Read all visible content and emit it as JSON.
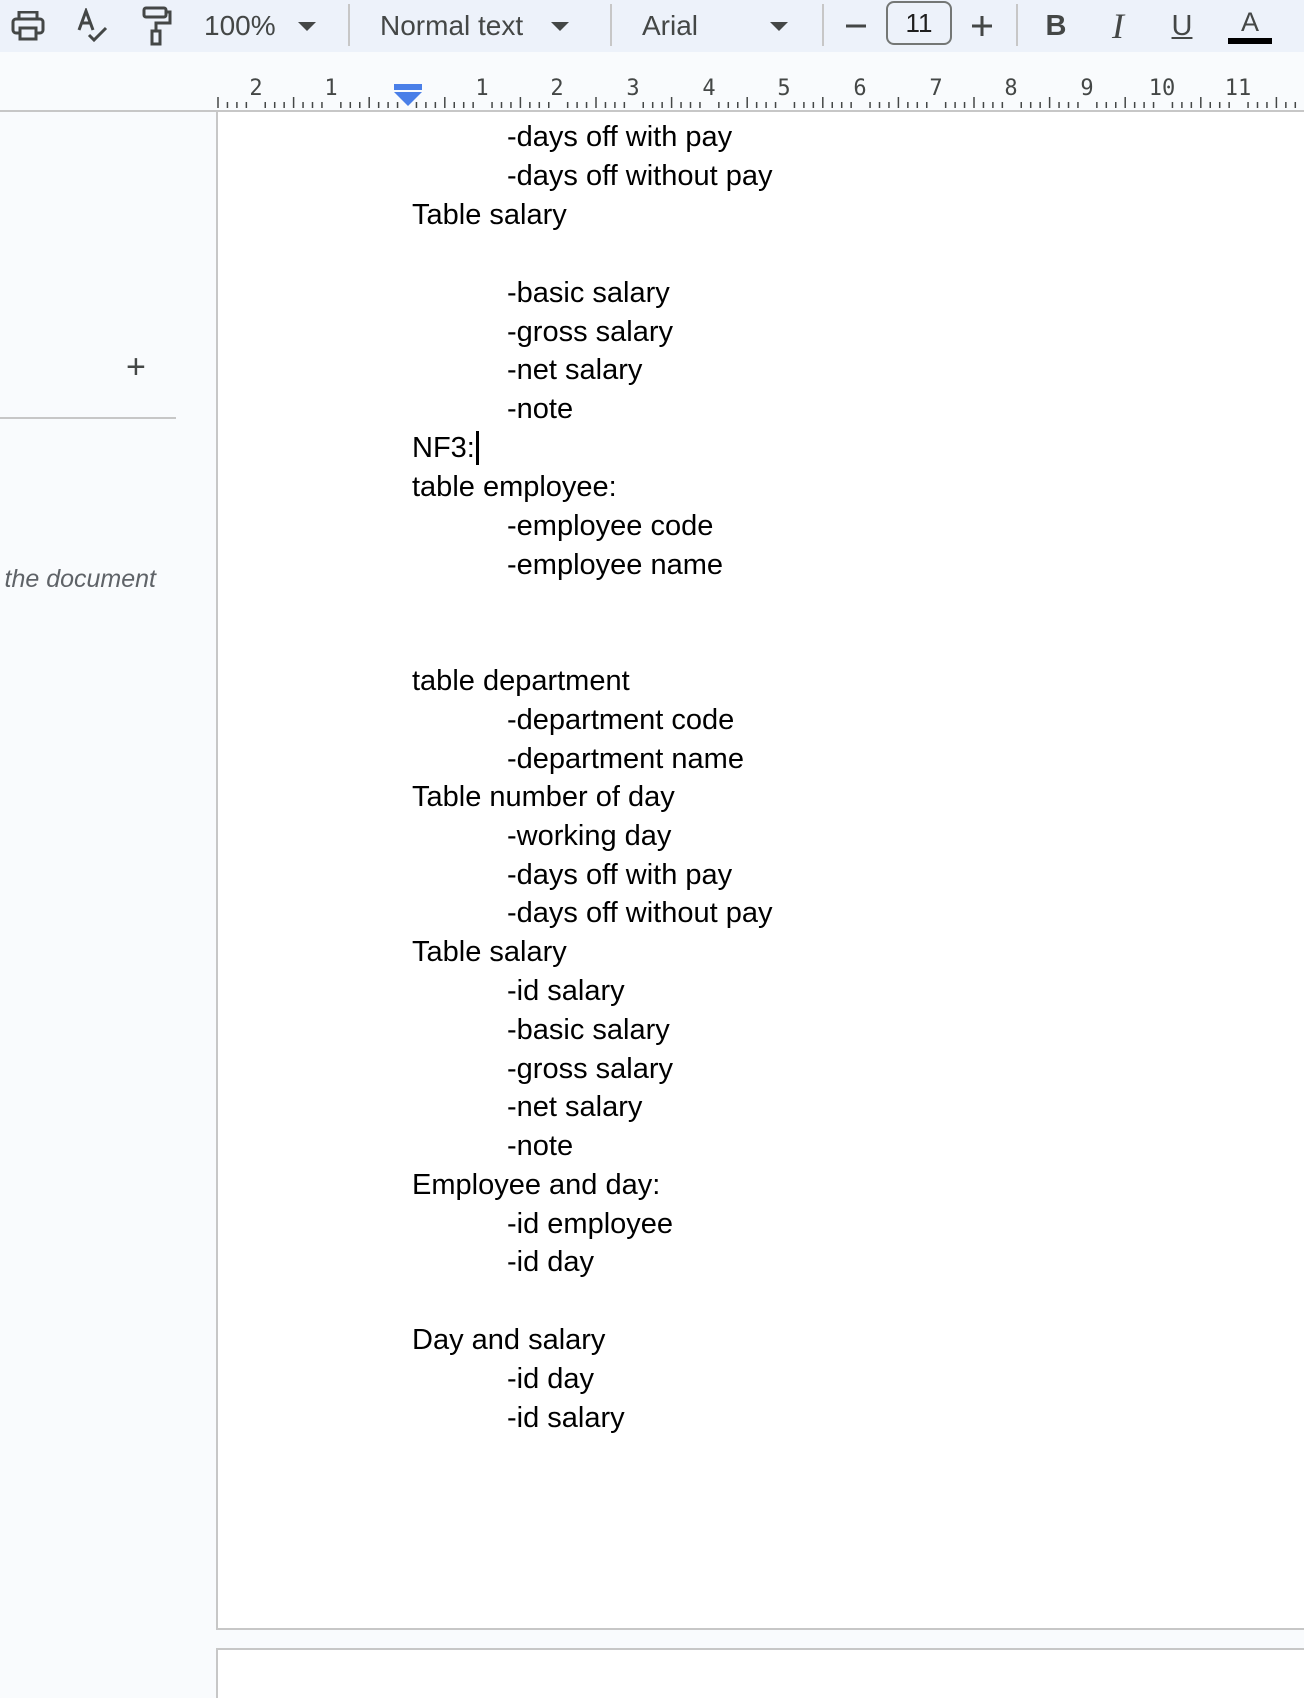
{
  "toolbar": {
    "zoom": "100%",
    "style": "Normal text",
    "font": "Arial",
    "font_size": "11",
    "bold_label": "B",
    "italic_label": "I",
    "underline_label": "U",
    "text_color_label": "A",
    "text_color": "#000000"
  },
  "ruler": {
    "labels": [
      "2",
      "1",
      "1",
      "2",
      "3",
      "4",
      "5",
      "6",
      "7",
      "8",
      "9",
      "10",
      "11"
    ],
    "indent_marker_color": "#4a7fe8"
  },
  "outline": {
    "hint": "the document"
  },
  "document": {
    "lines": [
      "-days off with pay",
      "-days off without pay",
      "Table salary",
      "-basic salary",
      "-gross salary",
      "-net salary",
      "-note",
      "NF3:",
      "table employee:",
      "-employee code",
      "-employee name",
      "table department",
      "-department code",
      "-department name",
      "Table number of day",
      "-working day",
      "-days off with pay",
      "-days off without pay",
      "Table salary",
      "-id salary",
      "-basic salary",
      "-gross salary",
      "-net salary",
      "-note",
      "Employee and day:",
      "-id employee",
      "-id day",
      "Day and salary",
      "-id day",
      "-id salary"
    ]
  }
}
